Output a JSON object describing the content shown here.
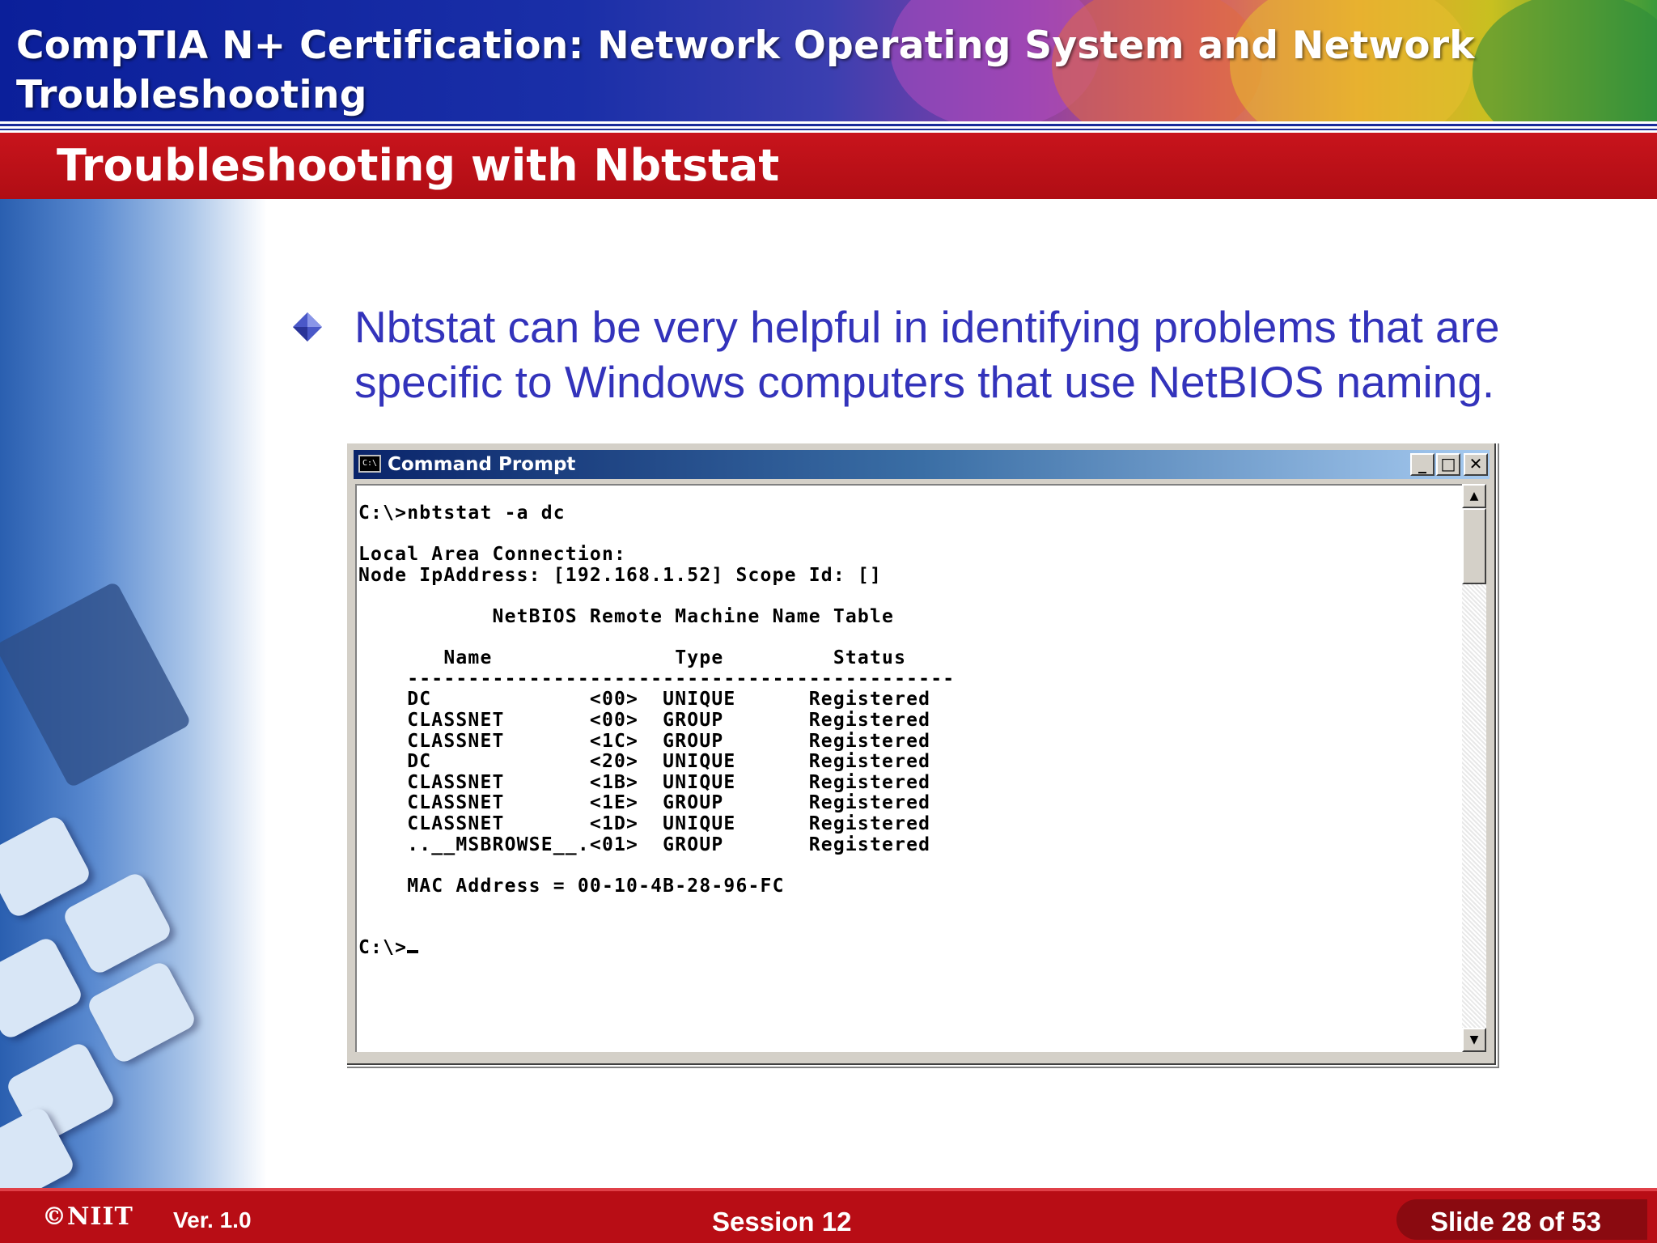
{
  "header": {
    "title": "CompTIA N+ Certification:  Network  Operating System and Network Troubleshooting"
  },
  "section": {
    "title": "Troubleshooting with Nbtstat"
  },
  "bullet": {
    "text": "Nbtstat can be very helpful in identifying problems that are specific to Windows computers that use NetBIOS naming."
  },
  "cmd_window": {
    "title": "Command Prompt",
    "icon_text": "C:\\",
    "output": "C:\\>nbtstat -a dc\n\nLocal Area Connection:\nNode IpAddress: [192.168.1.52] Scope Id: []\n\n           NetBIOS Remote Machine Name Table\n\n       Name               Type         Status\n    ---------------------------------------------\n    DC             <00>  UNIQUE      Registered\n    CLASSNET       <00>  GROUP       Registered\n    CLASSNET       <1C>  GROUP       Registered\n    DC             <20>  UNIQUE      Registered\n    CLASSNET       <1B>  UNIQUE      Registered\n    CLASSNET       <1E>  GROUP       Registered\n    CLASSNET       <1D>  UNIQUE      Registered\n    ..__MSBROWSE__.<01>  GROUP       Registered\n\n    MAC Address = 00-10-4B-28-96-FC\n\n\nC:\\>",
    "buttons": {
      "minimize": "_",
      "maximize": "□",
      "close": "✕"
    },
    "scroll_up": "▲",
    "scroll_down": "▼"
  },
  "footer": {
    "logo": "©NIIT",
    "version": "Ver.  1.0",
    "session": "Session 12",
    "slide": "Slide 28 of 53"
  },
  "colors": {
    "header_blue": "#0b1f9a",
    "section_red": "#b00d14",
    "bullet_text": "#3333bb",
    "footer_red": "#b80d15"
  },
  "icons": {
    "bullet": "diamond-bullet-icon",
    "cmd": "command-prompt-icon"
  }
}
